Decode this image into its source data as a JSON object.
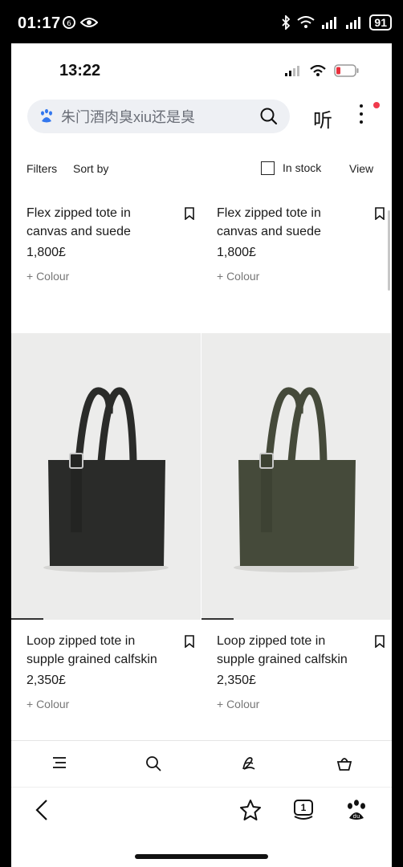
{
  "os_status": {
    "time": "01:17",
    "battery": "91"
  },
  "inner_status": {
    "time": "13:22"
  },
  "search": {
    "text": "朱门酒肉臭xiu还是臭"
  },
  "listen_label": "听",
  "toolbar": {
    "filters": "Filters",
    "sort": "Sort by",
    "in_stock": "In stock",
    "view": "View"
  },
  "products_top": [
    {
      "name": "Flex zipped tote in canvas and suede",
      "price": "1,800£",
      "colour": "+ Colour"
    },
    {
      "name": "Flex zipped tote in canvas and suede",
      "price": "1,800£",
      "colour": "+ Colour"
    }
  ],
  "products_bottom": [
    {
      "name": "Loop zipped tote in supple grained calfskin",
      "price": "2,350£",
      "colour": "+ Colour",
      "bag_color": "#2a2b29"
    },
    {
      "name": "Loop zipped tote in supple grained calfskin",
      "price": "2,350£",
      "colour": "+ Colour",
      "bag_color": "#454a3a"
    }
  ],
  "site_nav": {
    "icons": [
      "menu-icon",
      "search-icon",
      "logo-icon",
      "bag-icon"
    ]
  },
  "browser_bar": {
    "tabs_count": "1",
    "icons": [
      "back-icon",
      "star-icon",
      "tabs-icon",
      "baidu-icon"
    ]
  }
}
